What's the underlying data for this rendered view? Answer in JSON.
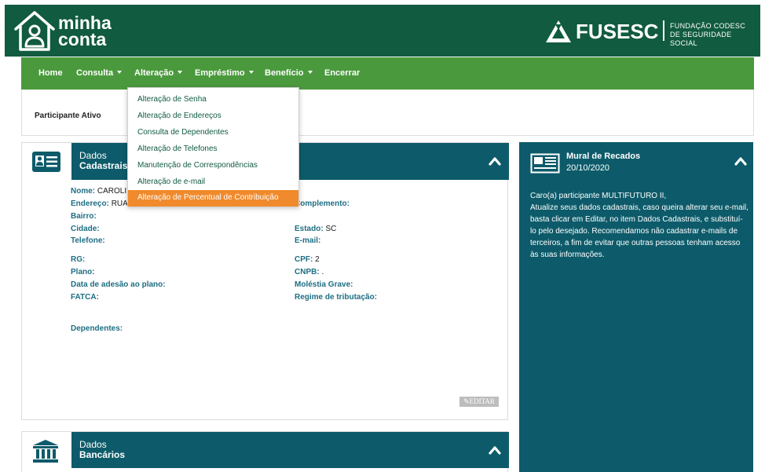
{
  "header": {
    "logo_line1": "minha",
    "logo_line2": "conta",
    "brand": "FUSESC",
    "brand_sub_line1": "FUNDAÇÃO CODESC",
    "brand_sub_line2": "DE SEGURIDADE SOCIAL"
  },
  "nav": {
    "items": [
      {
        "label": "Home"
      },
      {
        "label": "Consulta"
      },
      {
        "label": "Alteração"
      },
      {
        "label": "Empréstimo"
      },
      {
        "label": "Benefício"
      },
      {
        "label": "Encerrar"
      }
    ]
  },
  "status": {
    "text": "Participante Ativo"
  },
  "dropdown": {
    "items": [
      {
        "label": "Alteração de Senha"
      },
      {
        "label": "Alteração de Endereços"
      },
      {
        "label": "Consulta de Dependentes"
      },
      {
        "label": "Alteração de Telefones"
      },
      {
        "label": "Manutenção de Correspondências"
      },
      {
        "label": "Alteração de e-mail"
      },
      {
        "label": "Alteração de Percentual de Contribuição"
      }
    ]
  },
  "dados": {
    "title_line1": "Dados",
    "title_line2": "Cadastrais",
    "left_fields": [
      {
        "label": "Nome:",
        "value": "CAROLI"
      },
      {
        "label": "Endereço:",
        "value": "RUA"
      },
      {
        "label": "Bairro:",
        "value": ""
      },
      {
        "label": "Cidade:",
        "value": ""
      },
      {
        "label": "Telefone:",
        "value": ""
      }
    ],
    "right_fields": [
      {
        "label": "Complemento:",
        "value": ""
      },
      {
        "label": "Estado:",
        "value": "SC"
      },
      {
        "label": "E-mail:",
        "value": ""
      }
    ],
    "left_fields2": [
      {
        "label": "RG:",
        "value": ""
      },
      {
        "label": "Plano:",
        "value": ""
      },
      {
        "label": "Data de adesão ao plano:",
        "value": ""
      },
      {
        "label": "FATCA:",
        "value": ""
      }
    ],
    "right_fields2": [
      {
        "label": "CPF:",
        "value": "2"
      },
      {
        "label": "CNPB:",
        "value": "."
      },
      {
        "label": "Moléstia Grave:",
        "value": ""
      },
      {
        "label": "Regime de tributação:",
        "value": ""
      }
    ],
    "dependentes_label": "Dependentes:",
    "edit_label": "✎EDITAR"
  },
  "mural": {
    "title": "Mural de Recados",
    "date": "20/10/2020",
    "greeting": "Caro(a) participante MULTIFUTURO II,",
    "message": "Atualize seus dados cadastrais, caso queira alterar seu e-mail, basta clicar em Editar, no item Dados Cadastrais, e substituí-lo pelo desejado. Recomendamos não cadastrar e-mails de terceiros, a fim de evitar que outras pessoas tenham acesso às suas informações."
  },
  "banco": {
    "title_line1": "Dados",
    "title_line2": "Bancários"
  },
  "colors": {
    "header": "#115b40",
    "nav": "#4a9a3d",
    "card_head": "#0d5b6a",
    "active_item": "#f08a2c",
    "label": "#1e6e83"
  }
}
